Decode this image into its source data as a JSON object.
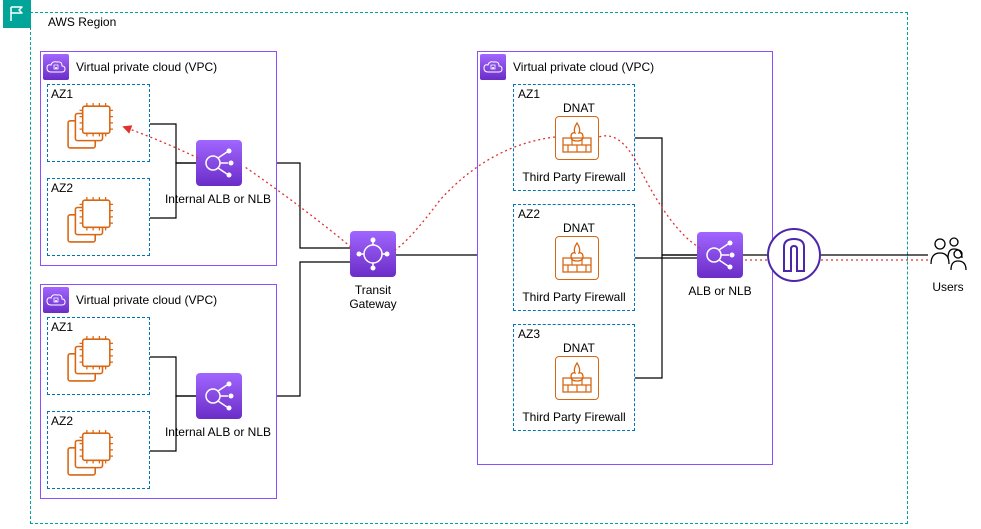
{
  "region": {
    "label": "AWS Region"
  },
  "vpc_a": {
    "label": "Virtual private cloud (VPC)",
    "az1": "AZ1",
    "az2": "AZ2",
    "lb_label": "Internal ALB or NLB"
  },
  "vpc_b": {
    "label": "Virtual private cloud (VPC)",
    "az1": "AZ1",
    "az2": "AZ2",
    "lb_label": "Internal ALB or NLB"
  },
  "tgw": {
    "label": "Transit Gateway"
  },
  "vpc_c": {
    "label": "Virtual private cloud (VPC)",
    "az1": {
      "name": "AZ1",
      "dnat": "DNAT",
      "fw": "Third Party Firewall"
    },
    "az2": {
      "name": "AZ2",
      "dnat": "DNAT",
      "fw": "Third Party Firewall"
    },
    "az3": {
      "name": "AZ3",
      "dnat": "DNAT",
      "fw": "Third Party Firewall"
    },
    "lb_label": "ALB or NLB"
  },
  "users": {
    "label": "Users"
  }
}
